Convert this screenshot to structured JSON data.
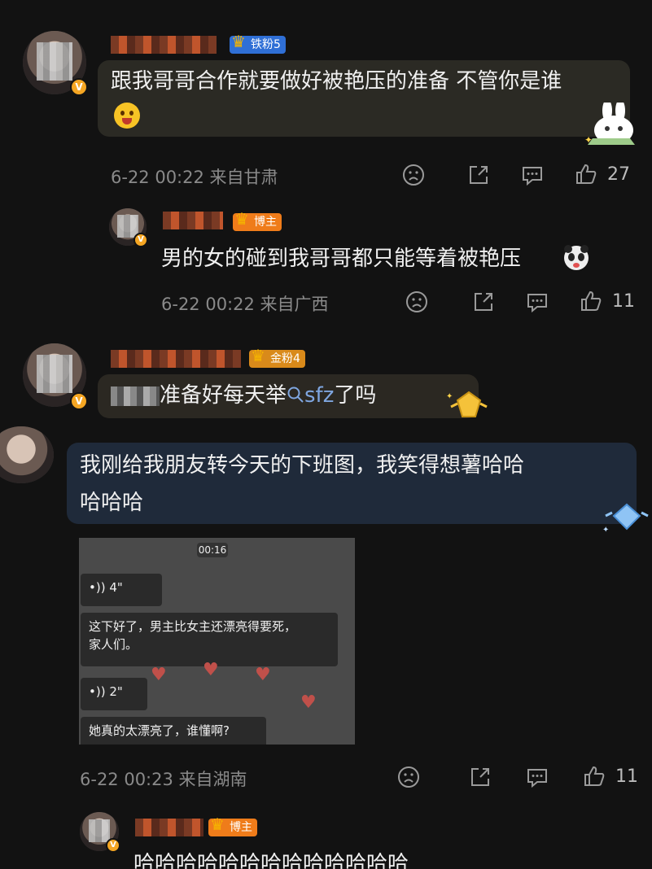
{
  "comments": [
    {
      "fan_badge": "铁粉5",
      "text": "跟我哥哥合作就要做好被艳压的准备 不管你是谁",
      "meta": "6-22 00:22 来自甘肃",
      "likes": "27",
      "reply": {
        "badge": "博主",
        "text": "男的女的碰到我哥哥都只能等着被艳压",
        "meta": "6-22 00:22 来自广西",
        "likes": "11"
      }
    },
    {
      "fan_badge": "金粉4",
      "text_suffix": "准备好每天举",
      "search_term": "sfz",
      "text_end": "了吗"
    },
    {
      "text_line1": "我刚给我朋友转今天的下班图，我笑得想薯哈哈",
      "text_line2": "哈哈哈",
      "screenshot": {
        "time": "00:16",
        "voice1": "4\"",
        "msg1_line1": "这下好了，男主比女主还漂亮得要死，",
        "msg1_line2": "家人们。",
        "voice2": "2\"",
        "msg2": "她真的太漂亮了，谁懂啊?"
      },
      "meta": "6-22 00:23 来自湖南",
      "likes": "11",
      "reply": {
        "badge": "博主",
        "text": "哈哈哈哈哈哈哈哈哈哈哈哈哈"
      }
    }
  ],
  "icons": {
    "verified": "v-badge-icon",
    "dislike": "sad-face-icon",
    "share": "share-icon",
    "comment": "comment-icon",
    "like": "thumb-up-icon",
    "search": "search-icon"
  },
  "colors": {
    "background": "#121212",
    "username": "#e0622a",
    "meta": "#8a8a8a",
    "search_link": "#7fa6e0"
  }
}
